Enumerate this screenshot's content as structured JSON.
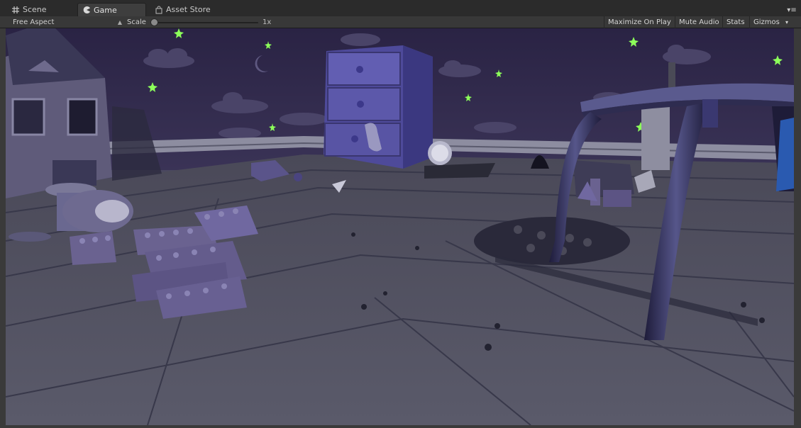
{
  "tabs": [
    {
      "label": "Scene",
      "icon": "hash-icon",
      "active": false
    },
    {
      "label": "Game",
      "icon": "pacman-icon",
      "active": true
    },
    {
      "label": "Asset Store",
      "icon": "bag-icon",
      "active": false
    }
  ],
  "toolbar": {
    "aspect": "Free Aspect",
    "scale_label": "Scale",
    "scale_value": "1x",
    "scale_fraction": 0.02,
    "maximize": "Maximize On Play",
    "mute": "Mute Audio",
    "stats": "Stats",
    "gizmos": "Gizmos"
  },
  "colors": {
    "sky": "#2e2748",
    "wall_stripe": "#8d8da0",
    "floor": "#4b4a5c",
    "toy_purple": "#6a6391",
    "dresser": "#4e4a9a",
    "star": "#8cff5a"
  }
}
